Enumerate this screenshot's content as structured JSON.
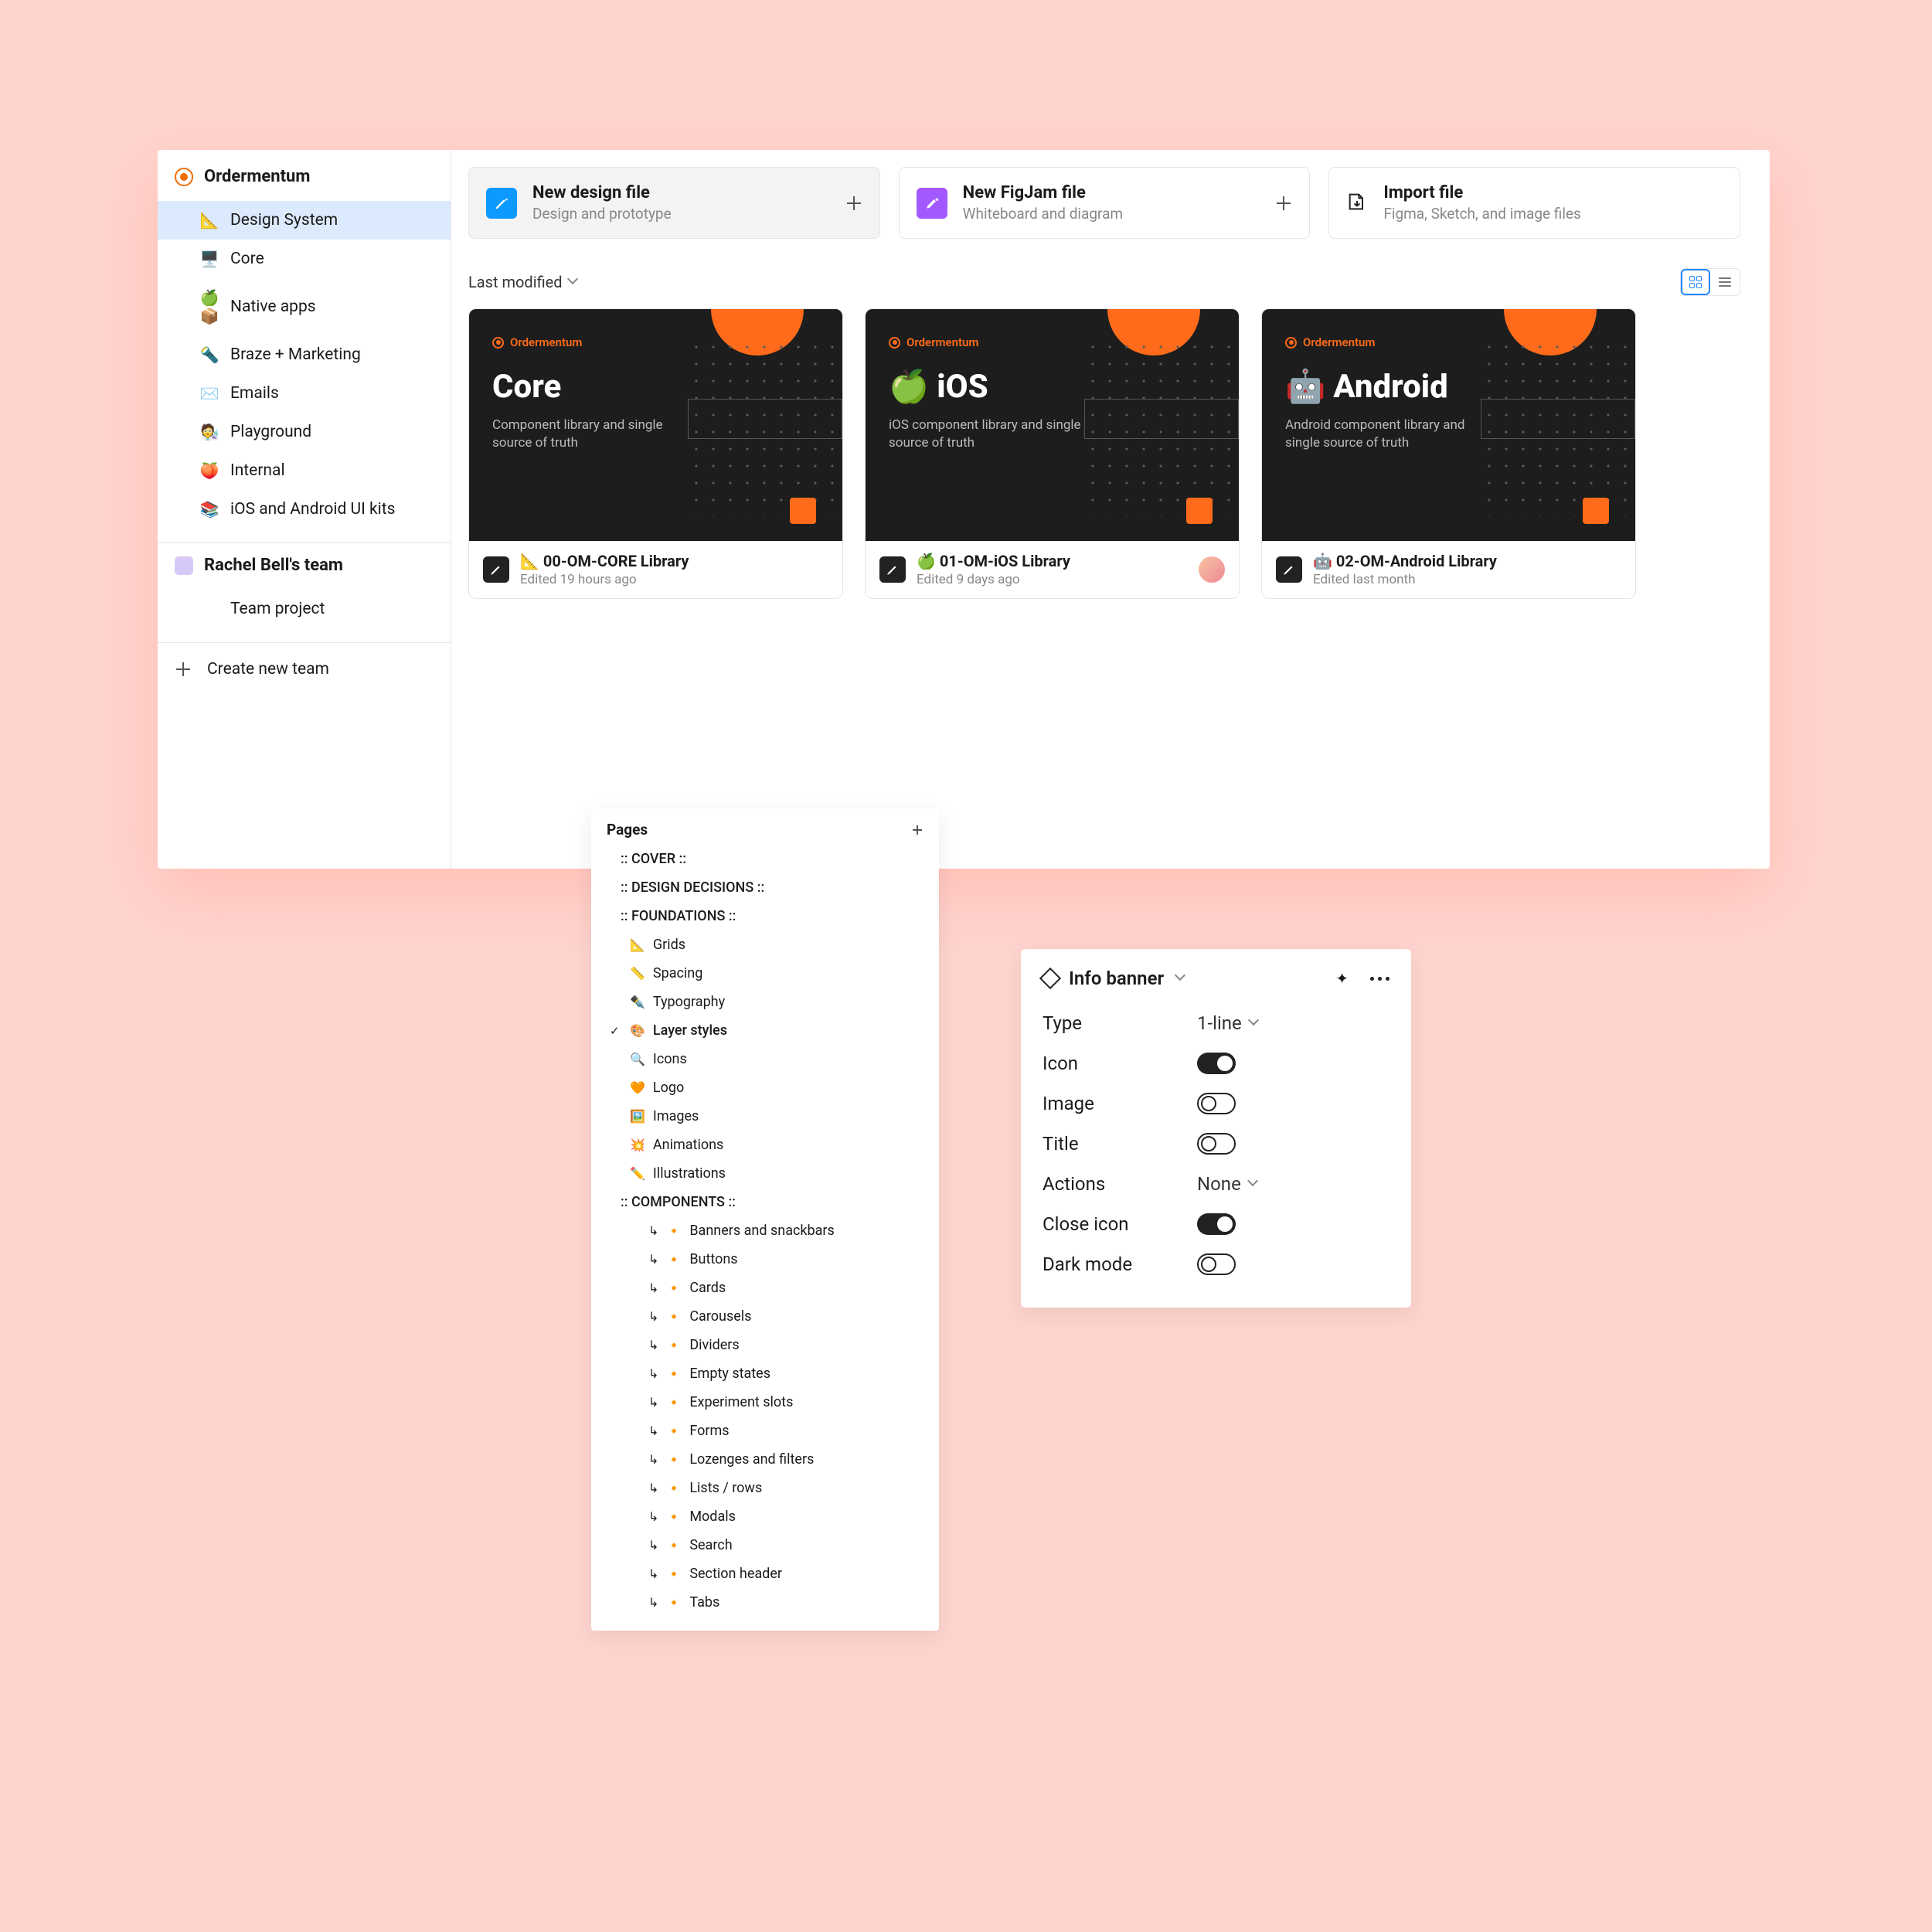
{
  "sidebar": {
    "team1": {
      "name": "Ordermentum"
    },
    "items1": [
      {
        "emoji": "📐",
        "label": "Design System",
        "selected": true
      },
      {
        "emoji": "🖥️",
        "label": "Core"
      },
      {
        "emoji": "🍏 📦",
        "label": "Native apps"
      },
      {
        "emoji": "🔦",
        "label": "Braze + Marketing"
      },
      {
        "emoji": "✉️",
        "label": "Emails"
      },
      {
        "emoji": "🧑‍🔬",
        "label": "Playground"
      },
      {
        "emoji": "🍑",
        "label": "Internal"
      },
      {
        "emoji": "📚",
        "label": "iOS and Android UI kits"
      }
    ],
    "team2": {
      "name": "Rachel Bell's team"
    },
    "items2": [
      {
        "emoji": "",
        "label": "Team project"
      }
    ],
    "create": "Create new team"
  },
  "create_cards": [
    {
      "title": "New design file",
      "subtitle": "Design and prototype",
      "kind": "design",
      "has_plus": true,
      "selected": true
    },
    {
      "title": "New FigJam file",
      "subtitle": "Whiteboard and diagram",
      "kind": "figjam",
      "has_plus": true
    },
    {
      "title": "Import file",
      "subtitle": "Figma, Sketch, and image files",
      "kind": "import",
      "has_plus": false
    }
  ],
  "filter": {
    "label": "Last modified"
  },
  "files": [
    {
      "brand": "Ordermentum",
      "title_emoji": "",
      "title": "Core",
      "subtitle": "Component library and single source of truth",
      "file_emoji": "📐",
      "file_name": "00-OM-CORE Library",
      "edited": "Edited 19 hours ago",
      "avatar": false
    },
    {
      "brand": "Ordermentum",
      "title_emoji": "🍏",
      "title": "iOS",
      "subtitle": "iOS component library and single source of truth",
      "file_emoji": "🍏",
      "file_name": "01-OM-iOS Library",
      "edited": "Edited 9 days ago",
      "avatar": true
    },
    {
      "brand": "Ordermentum",
      "title_emoji": "🤖",
      "title": "Android",
      "subtitle": "Android component library and single source of truth",
      "file_emoji": "🤖",
      "file_name": "02-OM-Android Library",
      "edited": "Edited last month",
      "avatar": false
    }
  ],
  "pages": {
    "title": "Pages",
    "items": [
      {
        "type": "section",
        "label": ":: COVER ::"
      },
      {
        "type": "section",
        "label": ":: DESIGN DECISIONS ::"
      },
      {
        "type": "section",
        "label": ":: FOUNDATIONS ::"
      },
      {
        "type": "item",
        "emoji": "📐",
        "label": "Grids"
      },
      {
        "type": "item",
        "emoji": "📏",
        "label": "Spacing"
      },
      {
        "type": "item",
        "emoji": "✒️",
        "label": "Typography"
      },
      {
        "type": "item",
        "emoji": "🎨",
        "label": "Layer styles",
        "selected": true
      },
      {
        "type": "item",
        "emoji": "🔍",
        "label": "Icons"
      },
      {
        "type": "item",
        "emoji": "🧡",
        "label": "Logo"
      },
      {
        "type": "item",
        "emoji": "🖼️",
        "label": "Images"
      },
      {
        "type": "item",
        "emoji": "💥",
        "label": "Animations"
      },
      {
        "type": "item",
        "emoji": "✏️",
        "label": "Illustrations"
      },
      {
        "type": "section",
        "label": ":: COMPONENTS ::"
      },
      {
        "type": "sub",
        "label": "Banners and snackbars"
      },
      {
        "type": "sub",
        "label": "Buttons"
      },
      {
        "type": "sub",
        "label": "Cards"
      },
      {
        "type": "sub",
        "label": "Carousels"
      },
      {
        "type": "sub",
        "label": "Dividers"
      },
      {
        "type": "sub",
        "label": "Empty states"
      },
      {
        "type": "sub",
        "label": "Experiment slots"
      },
      {
        "type": "sub",
        "label": "Forms"
      },
      {
        "type": "sub",
        "label": "Lozenges and filters"
      },
      {
        "type": "sub",
        "label": "Lists / rows"
      },
      {
        "type": "sub",
        "label": "Modals"
      },
      {
        "type": "sub",
        "label": "Search"
      },
      {
        "type": "sub",
        "label": "Section header"
      },
      {
        "type": "sub",
        "label": "Tabs"
      }
    ]
  },
  "props": {
    "component": "Info banner",
    "rows": [
      {
        "label": "Type",
        "kind": "select",
        "value": "1-line"
      },
      {
        "label": "Icon",
        "kind": "toggle",
        "on": true
      },
      {
        "label": "Image",
        "kind": "toggle",
        "on": false
      },
      {
        "label": "Title",
        "kind": "toggle",
        "on": false
      },
      {
        "label": "Actions",
        "kind": "select",
        "value": "None"
      },
      {
        "label": "Close icon",
        "kind": "toggle",
        "on": true
      },
      {
        "label": "Dark mode",
        "kind": "toggle",
        "on": false
      }
    ]
  }
}
